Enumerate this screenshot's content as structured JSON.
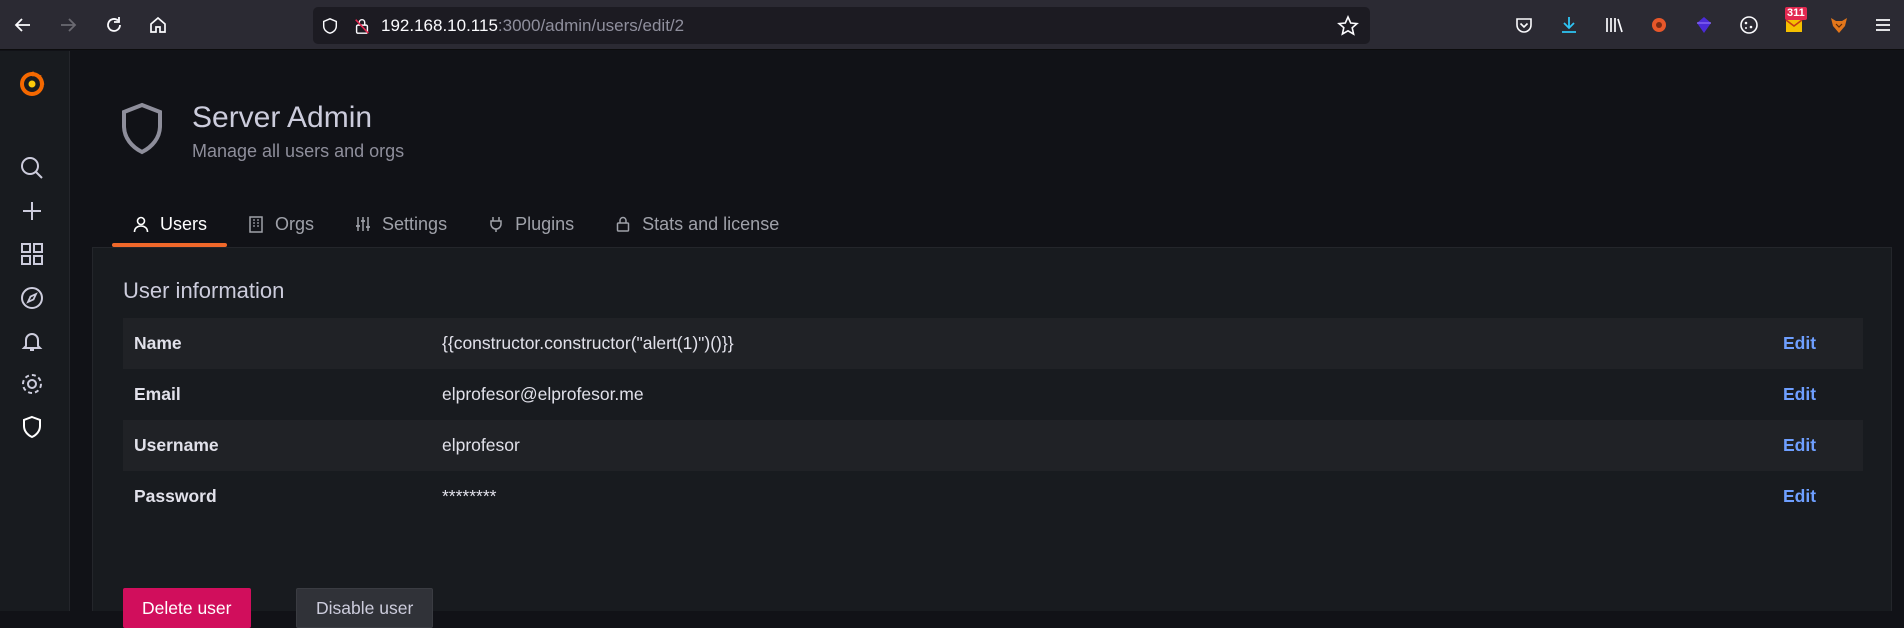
{
  "browser": {
    "url_host": "192.168.10.115",
    "url_rest": ":3000/admin/users/edit/2",
    "badge_count": "311",
    "icons": [
      "back-icon",
      "forward-icon",
      "reload-icon",
      "home-icon",
      "shield-icon",
      "lock-slash-icon",
      "bookmark-star-icon",
      "pocket-icon",
      "download-icon",
      "library-icon",
      "extension-icon",
      "extension-icon",
      "cookie-icon",
      "mail-icon",
      "fox-icon",
      "menu-icon"
    ]
  },
  "sidebar": {
    "items": [
      "grafana-logo",
      "search",
      "create",
      "dashboards",
      "explore",
      "alerting",
      "configuration",
      "server-admin"
    ]
  },
  "header": {
    "title": "Server Admin",
    "subtitle": "Manage all users and orgs"
  },
  "tabs": [
    {
      "label": "Users",
      "icon": "user-icon",
      "active": true
    },
    {
      "label": "Orgs",
      "icon": "building-icon",
      "active": false
    },
    {
      "label": "Settings",
      "icon": "sliders-icon",
      "active": false
    },
    {
      "label": "Plugins",
      "icon": "plug-icon",
      "active": false
    },
    {
      "label": "Stats and license",
      "icon": "lock-icon",
      "active": false
    }
  ],
  "user_info": {
    "title": "User information",
    "rows": [
      {
        "label": "Name",
        "value": "{{constructor.constructor(\"alert(1)\")()}}",
        "action": "Edit"
      },
      {
        "label": "Email",
        "value": "elprofesor@elprofesor.me",
        "action": "Edit"
      },
      {
        "label": "Username",
        "value": "elprofesor",
        "action": "Edit"
      },
      {
        "label": "Password",
        "value": "********",
        "action": "Edit"
      }
    ],
    "delete_label": "Delete user",
    "disable_label": "Disable user"
  },
  "colors": {
    "accent": "#f0682a",
    "danger": "#d10e5c",
    "link": "#6e9fff",
    "background": "#111217"
  }
}
